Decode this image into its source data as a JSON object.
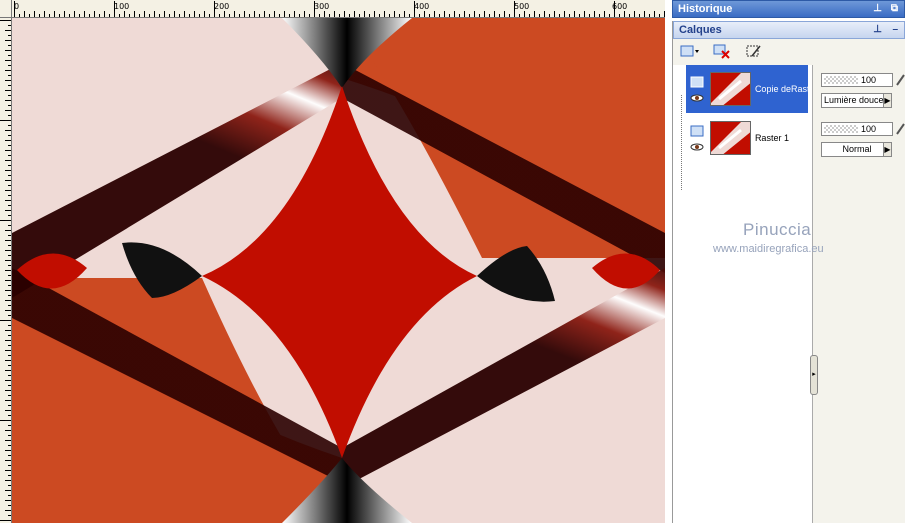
{
  "ruler": {
    "labels": [
      "0",
      "100",
      "200",
      "300",
      "400",
      "500",
      "600"
    ]
  },
  "panels": {
    "history": {
      "title": "Historique"
    },
    "layers": {
      "title": "Calques",
      "items": [
        {
          "name": "Copie deRast",
          "opacity": "100",
          "blend": "Lumière douce",
          "selected": true
        },
        {
          "name": "Raster 1",
          "opacity": "100",
          "blend": "Normal",
          "selected": false
        }
      ]
    }
  },
  "watermark": {
    "name": "Pinuccia",
    "url": "www.maidiregrafica.eu"
  },
  "colors": {
    "red": "#c10d00",
    "orange": "#cc4a22",
    "pink": "#efdad6",
    "accent": "#3a6cc4"
  },
  "icons": [
    "new-layer-icon",
    "delete-layer-icon",
    "mask-icon",
    "visibility-eye-icon",
    "layer-type-icon",
    "link-icon",
    "pin-icon",
    "float-icon",
    "close-icon"
  ]
}
